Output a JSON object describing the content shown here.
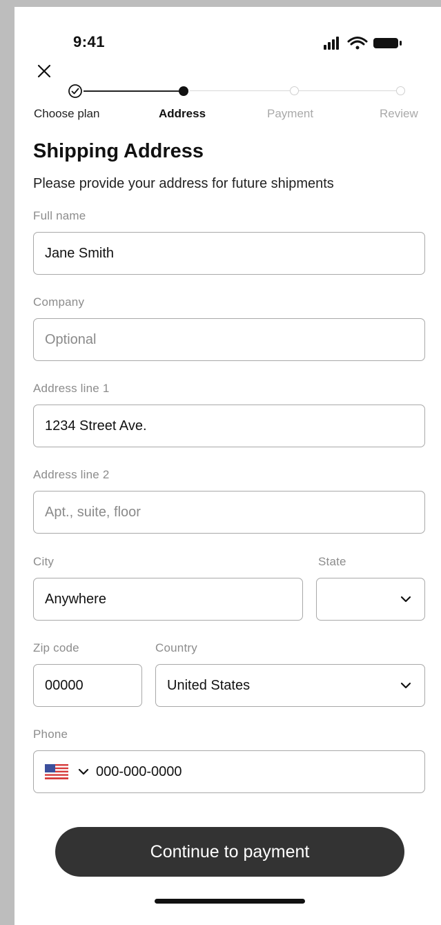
{
  "status_bar": {
    "time": "9:41"
  },
  "stepper": {
    "steps": [
      {
        "label": "Choose plan",
        "state": "done"
      },
      {
        "label": "Address",
        "state": "active"
      },
      {
        "label": "Payment",
        "state": "inactive"
      },
      {
        "label": "Review",
        "state": "inactive"
      }
    ]
  },
  "header": {
    "title": "Shipping Address",
    "subtitle": "Please provide your address for future shipments"
  },
  "form": {
    "full_name": {
      "label": "Full name",
      "value": "Jane Smith"
    },
    "company": {
      "label": "Company",
      "placeholder": "Optional"
    },
    "address1": {
      "label": "Address line 1",
      "value": "1234 Street Ave."
    },
    "address2": {
      "label": "Address line 2",
      "placeholder": "Apt., suite, floor"
    },
    "city": {
      "label": "City",
      "value": "Anywhere"
    },
    "state": {
      "label": "State",
      "value": ""
    },
    "zip": {
      "label": "Zip code",
      "value": "00000"
    },
    "country": {
      "label": "Country",
      "value": "United States"
    },
    "phone": {
      "label": "Phone",
      "value": "000-000-0000",
      "flag_icon": "us-flag-icon"
    }
  },
  "actions": {
    "continue_label": "Continue to payment"
  },
  "colors": {
    "button_bg": "#333333",
    "border": "#a8a8a8",
    "label": "#8c8c8c",
    "step_active": "#111111",
    "step_inactive": "#d8d8d8"
  }
}
